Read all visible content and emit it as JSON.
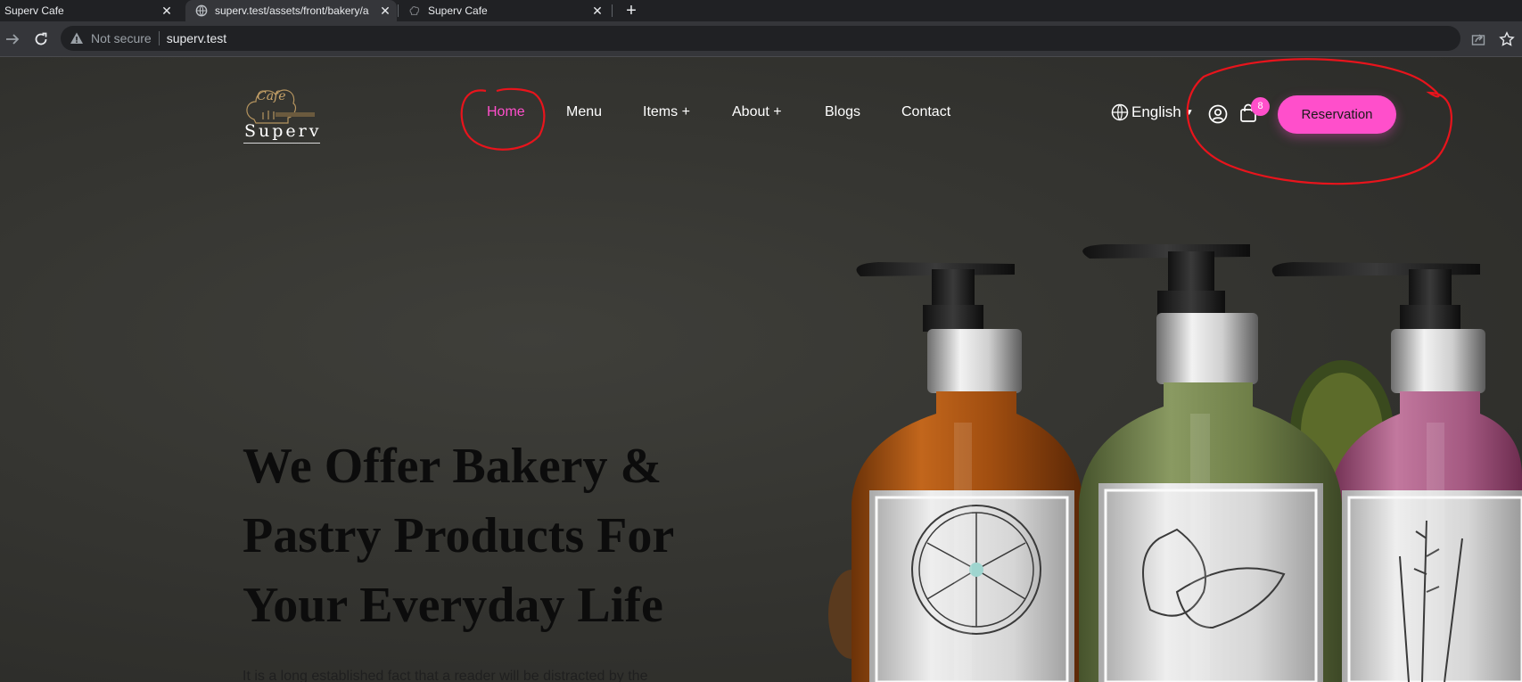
{
  "browser": {
    "tabs": [
      {
        "title": "Superv Cafe",
        "active": false
      },
      {
        "title": "superv.test/assets/front/bakery/a",
        "active": true
      },
      {
        "title": "Superv Cafe",
        "active": false
      }
    ],
    "security_label": "Not secure",
    "url": "superv.test"
  },
  "site": {
    "logo": {
      "script": "Cafe",
      "name": "Superv"
    },
    "nav": [
      {
        "label": "Home",
        "active": true
      },
      {
        "label": "Menu",
        "active": false
      },
      {
        "label": "Items +",
        "active": false
      },
      {
        "label": "About +",
        "active": false
      },
      {
        "label": "Blogs",
        "active": false
      },
      {
        "label": "Contact",
        "active": false
      }
    ],
    "language": "English",
    "cart_count": "8",
    "reservation_label": "Reservation",
    "accent_color": "#ff4fcb",
    "icons": [
      "globe-icon",
      "chevron-down-icon",
      "user-icon",
      "shopping-bag-icon"
    ]
  },
  "hero": {
    "title_lines": [
      "We Offer Bakery &",
      "Pastry Products For",
      "Your Everyday Life"
    ],
    "text": "It is a long established fact that a reader will be distracted by the"
  }
}
